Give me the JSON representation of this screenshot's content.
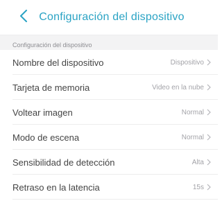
{
  "header": {
    "title": "Configuración del dispositivo",
    "back_icon": "chevron-left-icon",
    "accent_color": "#2aa3c4"
  },
  "section": {
    "label": "Configuración del dispositivo"
  },
  "settings": [
    {
      "label": "Nombre del dispositivo",
      "value": "Dispositivo"
    },
    {
      "label": "Tarjeta de memoria",
      "value": "Video en la nube"
    },
    {
      "label": "Voltear imagen",
      "value": "Normal"
    },
    {
      "label": "Modo de escena",
      "value": "Normal"
    },
    {
      "label": "Sensibilidad de detección",
      "value": "Alta"
    },
    {
      "label": "Retraso en la latencia",
      "value": "15s"
    }
  ]
}
